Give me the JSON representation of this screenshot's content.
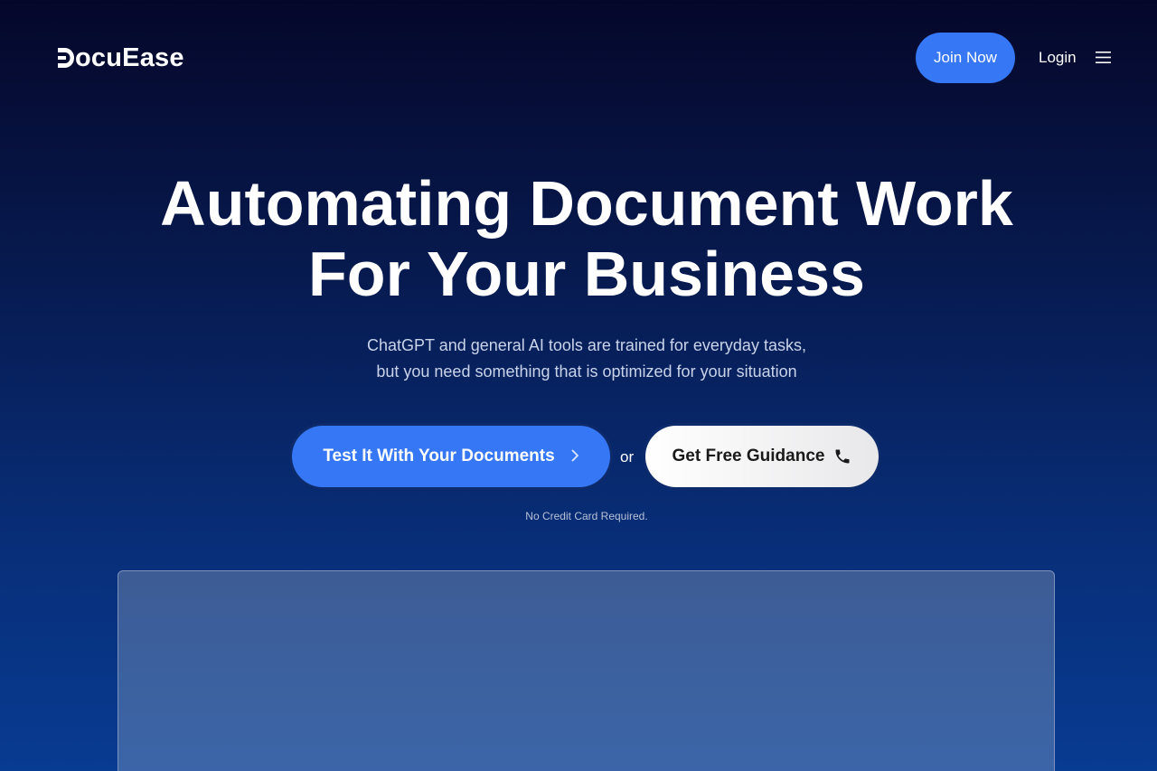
{
  "brand": {
    "name": "DocuEase",
    "name_rest": "ocuEase"
  },
  "nav": {
    "join_label": "Join Now",
    "login_label": "Login",
    "menu_icon": "hamburger-menu-icon"
  },
  "hero": {
    "title_line1": "Automating Document Work",
    "title_line2": "For Your Business",
    "subtitle_line1": "ChatGPT and general AI tools are trained for everyday tasks,",
    "subtitle_line2": "but you need something that is optimized for your situation"
  },
  "cta": {
    "primary_label": "Test It With Your Documents",
    "primary_icon": "chevron-right-icon",
    "or_label": "or",
    "secondary_label": "Get Free Guidance",
    "secondary_icon": "phone-icon",
    "note": "No Credit Card Required."
  },
  "colors": {
    "accent": "#3577f5",
    "background_top": "#05072a",
    "background_bottom": "#083b92"
  }
}
